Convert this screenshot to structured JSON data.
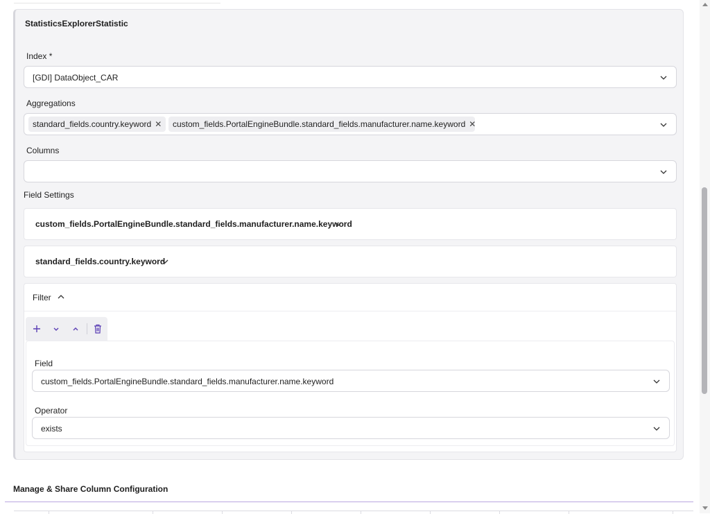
{
  "panel": {
    "title": "StatisticsExplorerStatistic",
    "index": {
      "label": "Index *",
      "value": "[GDI] DataObject_CAR"
    },
    "aggregations": {
      "label": "Aggregations",
      "tags": [
        "standard_fields.country.keyword",
        "custom_fields.PortalEngineBundle.standard_fields.manufacturer.name.keyword"
      ]
    },
    "columns": {
      "label": "Columns",
      "value": ""
    },
    "field_settings": {
      "label": "Field Settings",
      "items": [
        "custom_fields.PortalEngineBundle.standard_fields.manufacturer.name.keyword",
        "standard_fields.country.keyword"
      ]
    },
    "filter": {
      "title": "Filter",
      "field": {
        "label": "Field",
        "value": "custom_fields.PortalEngineBundle.standard_fields.manufacturer.name.keyword"
      },
      "operator": {
        "label": "Operator",
        "value": "exists"
      }
    }
  },
  "section": {
    "title": "Manage & Share Column Configuration"
  },
  "colors": {
    "accent": "#5b3fb5",
    "divider": "#b9a6e0"
  }
}
